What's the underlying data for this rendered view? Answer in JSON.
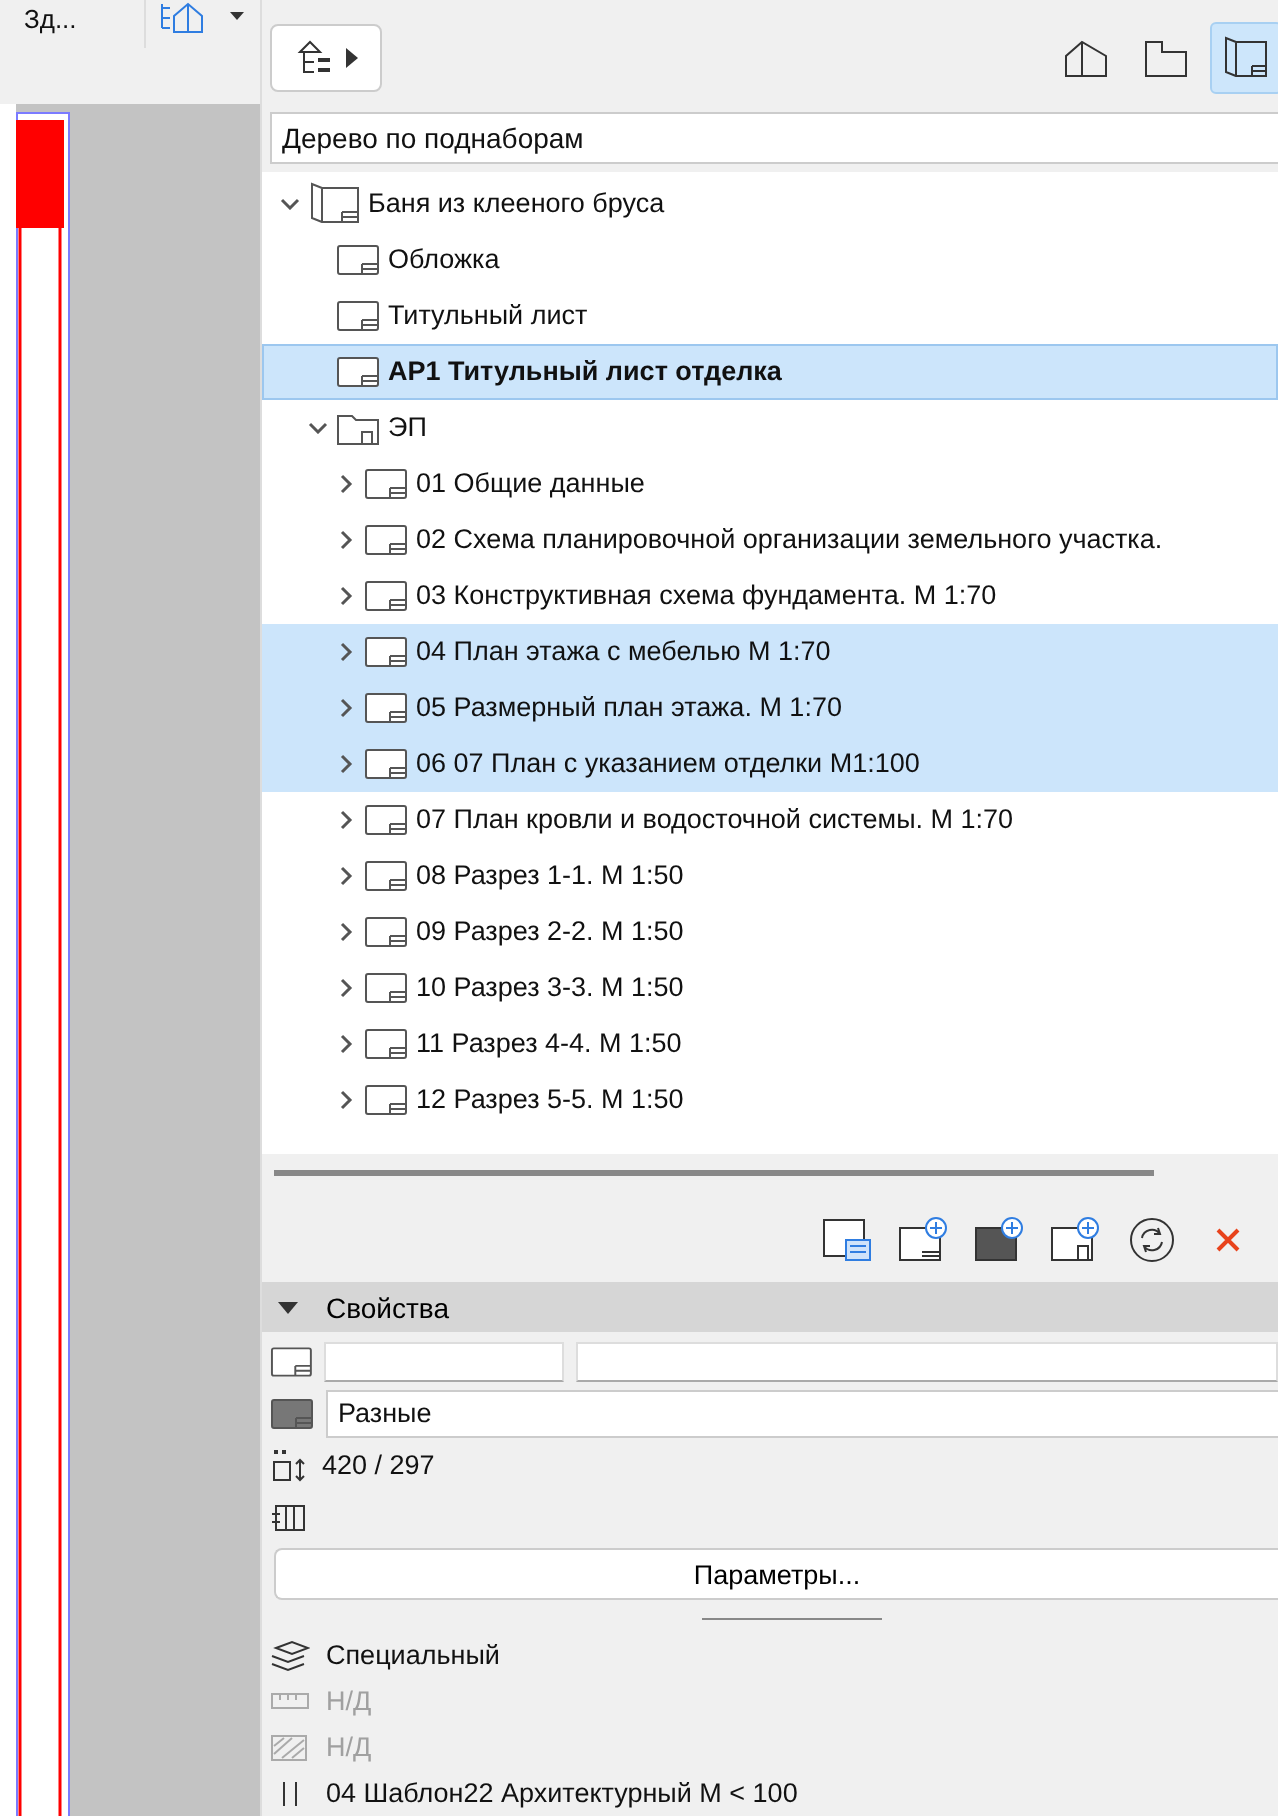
{
  "left_pane": {
    "tab_label": "Зд..."
  },
  "toolbar": {
    "views": [
      {
        "kind": "model",
        "selected": false
      },
      {
        "kind": "layout",
        "selected": false
      },
      {
        "kind": "book",
        "selected": true
      }
    ]
  },
  "view_mode": {
    "value": "Дерево по поднаборам"
  },
  "tree": [
    {
      "label": "Баня из клееного бруса",
      "kind": "book",
      "expanded": true,
      "selected": false,
      "current": false,
      "children": [
        {
          "label": "Обложка",
          "kind": "sheet",
          "selected": false,
          "current": false
        },
        {
          "label": "Титульный лист",
          "kind": "sheet",
          "selected": false,
          "current": false
        },
        {
          "label": "АР1 Титульный лист отделка",
          "kind": "sheet",
          "selected": true,
          "current": true
        },
        {
          "label": "ЭП",
          "kind": "folder",
          "expanded": true,
          "selected": false,
          "current": false,
          "children": [
            {
              "label": "01 Общие данные",
              "kind": "sheet",
              "expanded": false,
              "selected": false,
              "current": false
            },
            {
              "label": "02 Схема планировочной организации земельного участка.",
              "kind": "sheet",
              "expanded": false,
              "selected": false,
              "current": false
            },
            {
              "label": "03 Конструктивная схема фундамента.  М 1:70",
              "kind": "sheet",
              "expanded": false,
              "selected": false,
              "current": false
            },
            {
              "label": "04 План этажа с мебелью  М 1:70",
              "kind": "sheet",
              "expanded": false,
              "selected": true,
              "current": false
            },
            {
              "label": "05 Размерный план этажа.  М 1:70",
              "kind": "sheet",
              "expanded": false,
              "selected": true,
              "current": false
            },
            {
              "label": "06 07 План с указанием отделки М1:100",
              "kind": "sheet",
              "expanded": false,
              "selected": true,
              "current": false
            },
            {
              "label": "07 План кровли и водосточной системы.  М 1:70",
              "kind": "sheet",
              "expanded": false,
              "selected": false,
              "current": false
            },
            {
              "label": "08 Разрез 1-1.  М 1:50",
              "kind": "sheet",
              "expanded": false,
              "selected": false,
              "current": false
            },
            {
              "label": "09 Разрез 2-2.  М 1:50",
              "kind": "sheet",
              "expanded": false,
              "selected": false,
              "current": false
            },
            {
              "label": "10 Разрез 3-3.  М 1:50",
              "kind": "sheet",
              "expanded": false,
              "selected": false,
              "current": false
            },
            {
              "label": "11 Разрез 4-4.  М 1:50",
              "kind": "sheet",
              "expanded": false,
              "selected": false,
              "current": false
            },
            {
              "label": "12 Разрез 5-5.  М 1:50",
              "kind": "sheet",
              "expanded": false,
              "selected": false,
              "current": false
            }
          ]
        }
      ]
    }
  ],
  "properties": {
    "title": "Свойства",
    "expanded": true,
    "master": "Разные",
    "size": "420 / 297",
    "parameters_button": "Параметры..."
  },
  "info": [
    {
      "kind": "layer",
      "label": "Специальный",
      "disabled": false
    },
    {
      "kind": "scale",
      "label": "Н/Д",
      "disabled": true
    },
    {
      "kind": "hatch",
      "label": "Н/Д",
      "disabled": true
    },
    {
      "kind": "template",
      "label": "04 Шаблон22 Архитектурный М < 100",
      "disabled": false
    }
  ]
}
